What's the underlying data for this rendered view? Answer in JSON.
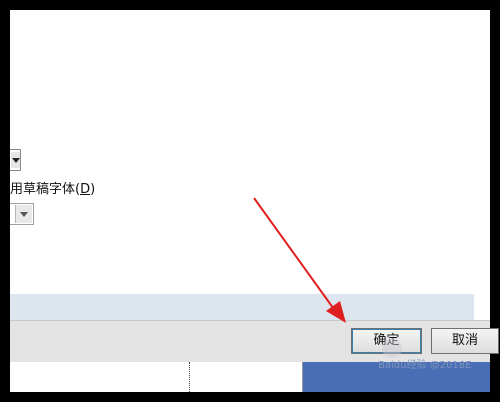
{
  "dialog": {
    "draft_font_label": "用草稿字体(",
    "draft_font_hotkey": "D",
    "draft_font_suffix": ")"
  },
  "buttons": {
    "ok_label": "确定",
    "cancel_label": "取消"
  },
  "watermark": {
    "text": "Baidu经验 @2018E"
  },
  "colors": {
    "annotation_arrow": "#e02020",
    "button_focus": "#3c7fb1",
    "info_bar": "#dde6ee",
    "doc_blue": "#4a6eb5"
  }
}
